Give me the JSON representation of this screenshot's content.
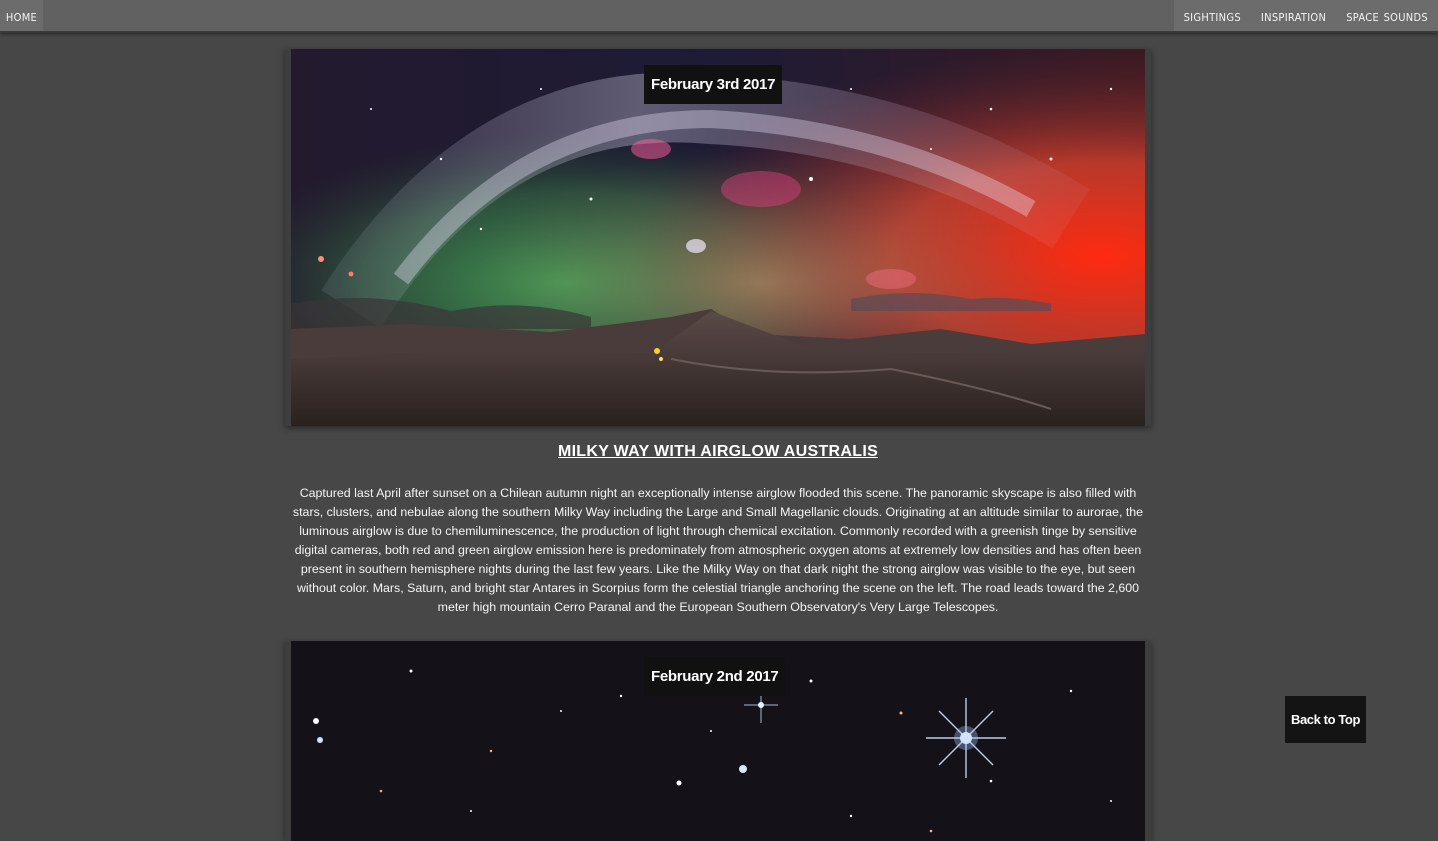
{
  "nav": {
    "home": "Home",
    "items": [
      "Sightings",
      "Inspiration",
      "Space Sounds"
    ]
  },
  "posts": [
    {
      "date": "February 3rd 2017",
      "title": "MILKY WAY WITH AIRGLOW AUSTRALIS",
      "image_alt": "Milky Way arching over Cerro Paranal with green and red airglow",
      "description": "Captured last April after sunset on a Chilean autumn night an exceptionally intense airglow flooded this scene. The panoramic skyscape is also filled with stars, clusters, and nebulae along the southern Milky Way including the Large and Small Magellanic clouds. Originating at an altitude similar to aurorae, the luminous airglow is due to chemiluminescence, the production of light through chemical excitation. Commonly recorded with a greenish tinge by sensitive digital cameras, both red and green airglow emission here is predominately from atmospheric oxygen atoms at extremely low densities and has often been present in southern hemisphere nights during the last few years. Like the Milky Way on that dark night the strong airglow was visible to the eye, but seen without color. Mars, Saturn, and bright star Antares in Scorpius form the celestial triangle anchoring the scene on the left. The road leads toward the 2,600 meter high mountain Cerro Paranal and the European Southern Observatory's Very Large Telescopes."
    },
    {
      "date": "February 2nd 2017",
      "image_alt": "Dense star field with bright blue stars"
    }
  ],
  "back_to_top": "Back to Top",
  "colors": {
    "page_bg": "#474747",
    "nav_bg": "#616161",
    "badge_bg": "#111111"
  }
}
